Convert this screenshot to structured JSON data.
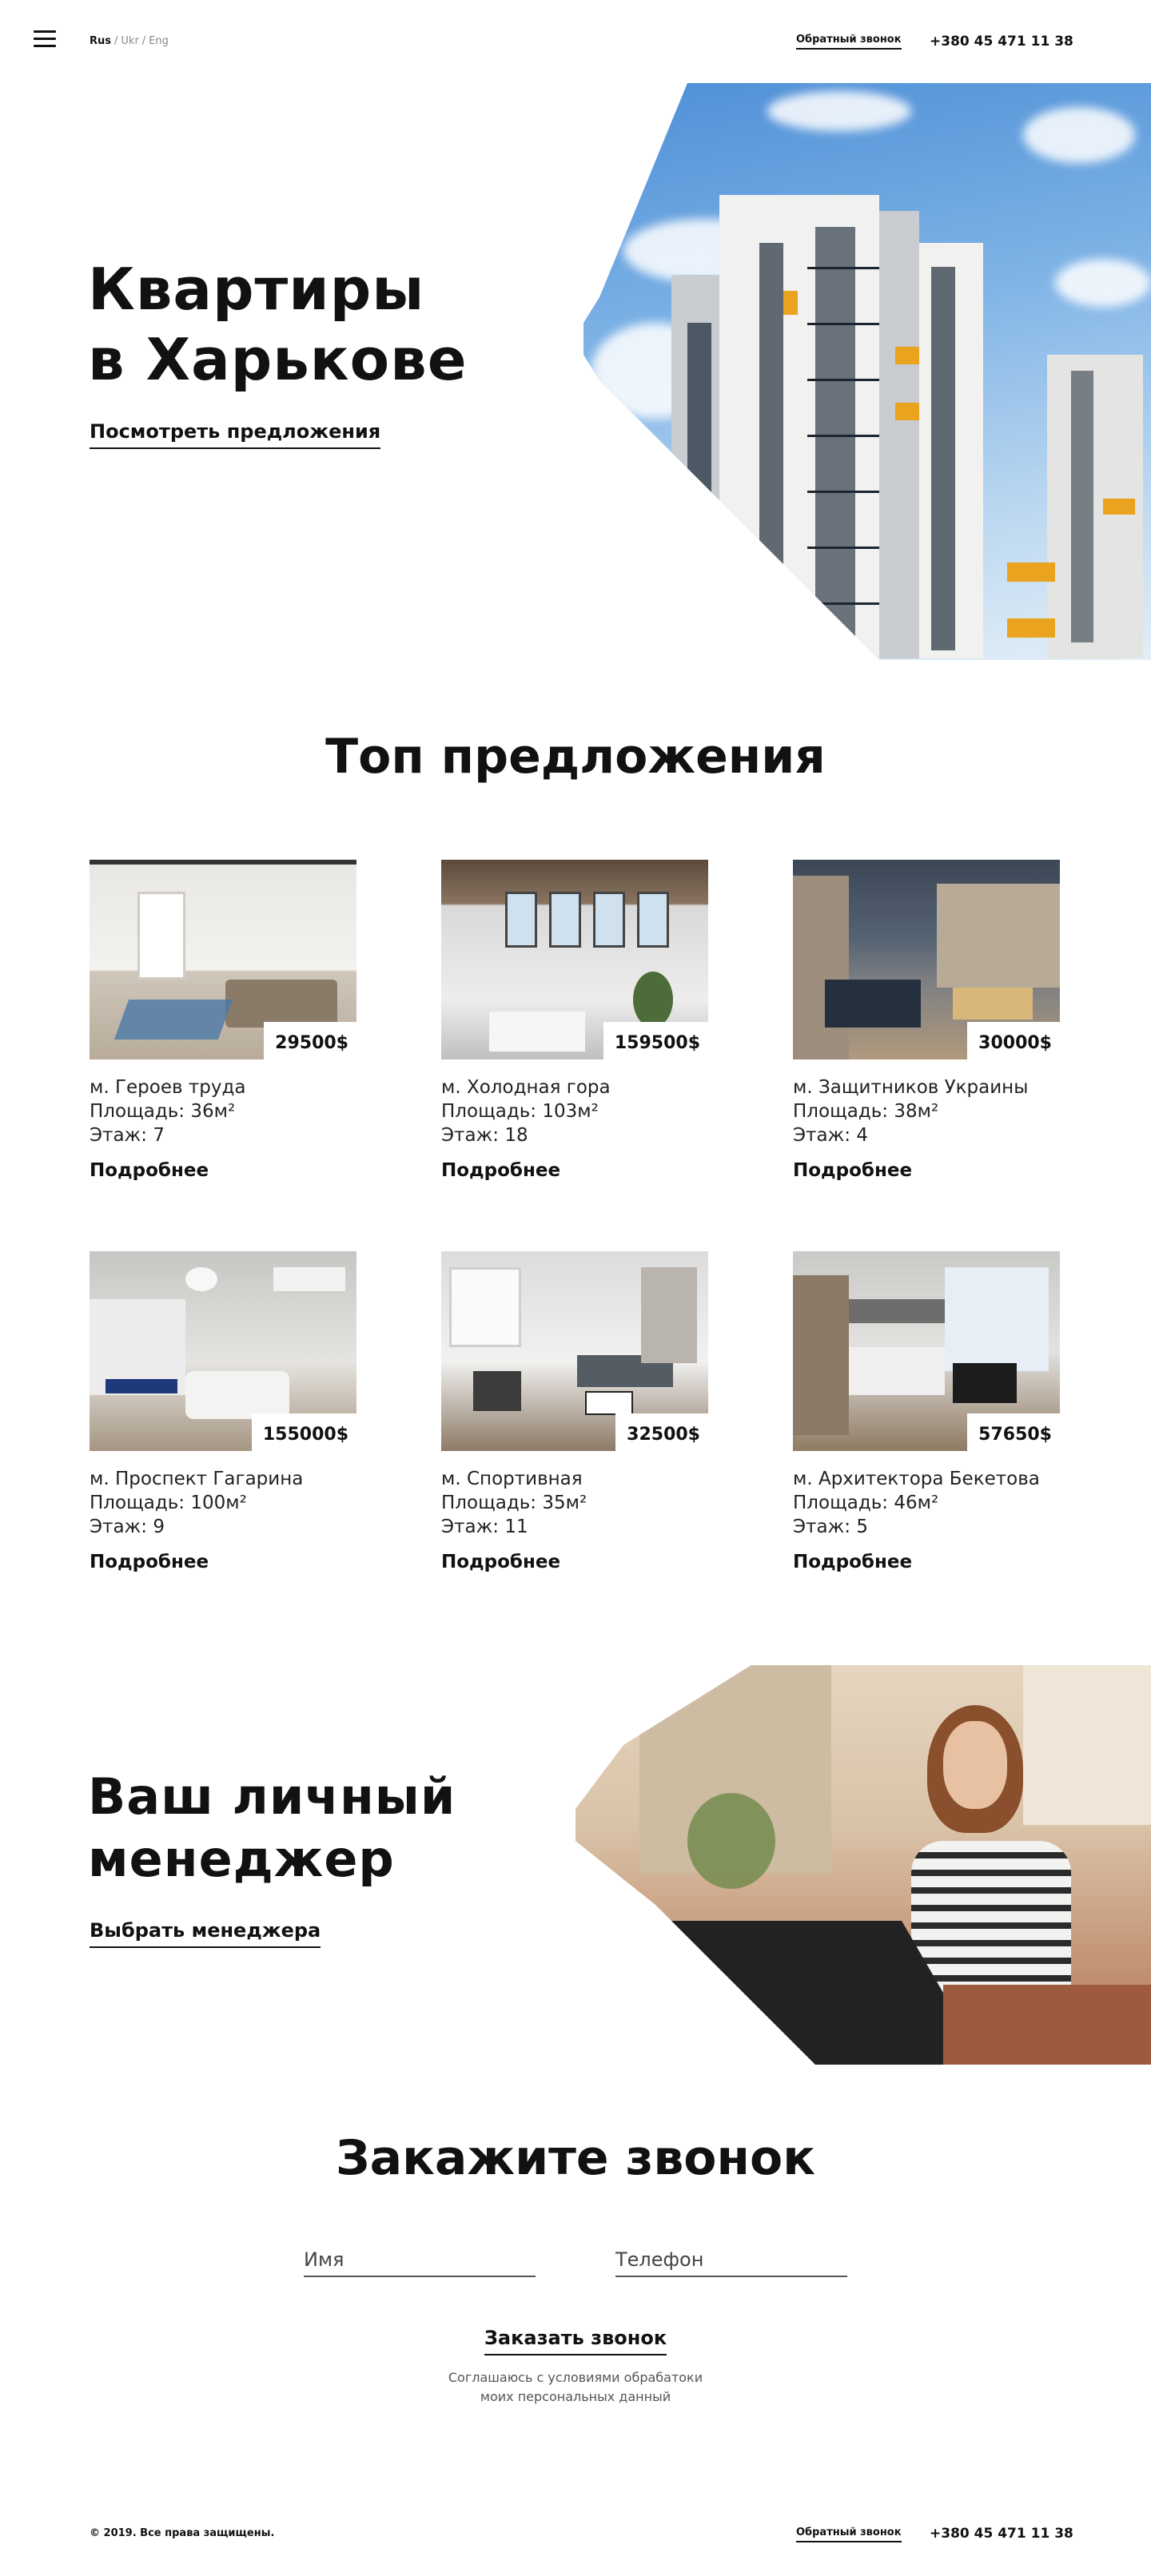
{
  "header": {
    "languages": [
      {
        "label": "Rus",
        "active": true
      },
      {
        "label": "Ukr",
        "active": false
      },
      {
        "label": "Eng",
        "active": false
      }
    ],
    "language_separator": "/",
    "callback_label": "Обратный звонок",
    "phone": "+380 45 471 11 38"
  },
  "hero": {
    "title_line1": "Квартиры",
    "title_line2": "в Харькове",
    "link_label": "Посмотреть предложения"
  },
  "offers": {
    "title": "Топ предложения",
    "more_label": "Подробнее",
    "items": [
      {
        "price": "29500$",
        "metro": "м. Героев труда",
        "area": "Площадь: 36м²",
        "floor": "Этаж: 7"
      },
      {
        "price": "159500$",
        "metro": "м. Холодная гора",
        "area": "Площадь: 103м²",
        "floor": "Этаж: 18"
      },
      {
        "price": "30000$",
        "metro": "м. Защитников Украины",
        "area": "Площадь: 38м²",
        "floor": "Этаж: 4"
      },
      {
        "price": "155000$",
        "metro": "м. Проспект Гагарина",
        "area": "Площадь: 100м²",
        "floor": "Этаж: 9"
      },
      {
        "price": "32500$",
        "metro": "м. Спортивная",
        "area": "Площадь: 35м²",
        "floor": "Этаж: 11"
      },
      {
        "price": "57650$",
        "metro": "м. Архитектора Бекетова",
        "area": "Площадь: 46м²",
        "floor": "Этаж: 5"
      }
    ]
  },
  "manager": {
    "title_line1": "Ваш личный",
    "title_line2": "менеджер",
    "link_label": "Выбрать менеджера"
  },
  "callback_form": {
    "title": "Закажите звонок",
    "name_placeholder": "Имя",
    "phone_placeholder": "Телефон",
    "submit_label": "Заказать звонок",
    "consent_line1": "Соглашаюсь с условиями обрабатоки",
    "consent_line2": "моих персональных данный"
  },
  "footer": {
    "copyright": "© 2019. Все права защищены.",
    "callback_label": "Обратный звонок",
    "phone": "+380 45 471 11 38"
  },
  "colors": {
    "text": "#111111",
    "accent_orange": "#e9a31f",
    "background": "#ffffff"
  }
}
